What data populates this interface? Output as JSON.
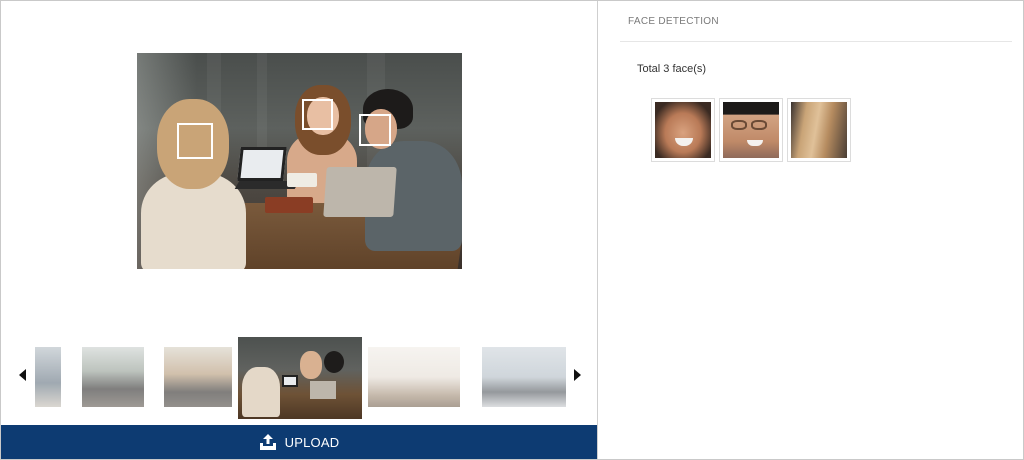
{
  "upload": {
    "label": "UPLOAD"
  },
  "face_detection": {
    "header": "FACE DETECTION",
    "total_text": "Total 3 face(s)"
  },
  "thumbnails": [
    {
      "name": "thumb-1",
      "selected": false
    },
    {
      "name": "thumb-2",
      "selected": false
    },
    {
      "name": "thumb-3",
      "selected": false
    },
    {
      "name": "thumb-4",
      "selected": true
    },
    {
      "name": "thumb-5",
      "selected": false
    },
    {
      "name": "thumb-6",
      "selected": false
    }
  ],
  "colors": {
    "upload_bar": "#0d3b72",
    "face_box": "#ffffff"
  },
  "icons": {
    "upload": "upload-icon",
    "prev": "chevron-left-icon",
    "next": "chevron-right-icon"
  }
}
